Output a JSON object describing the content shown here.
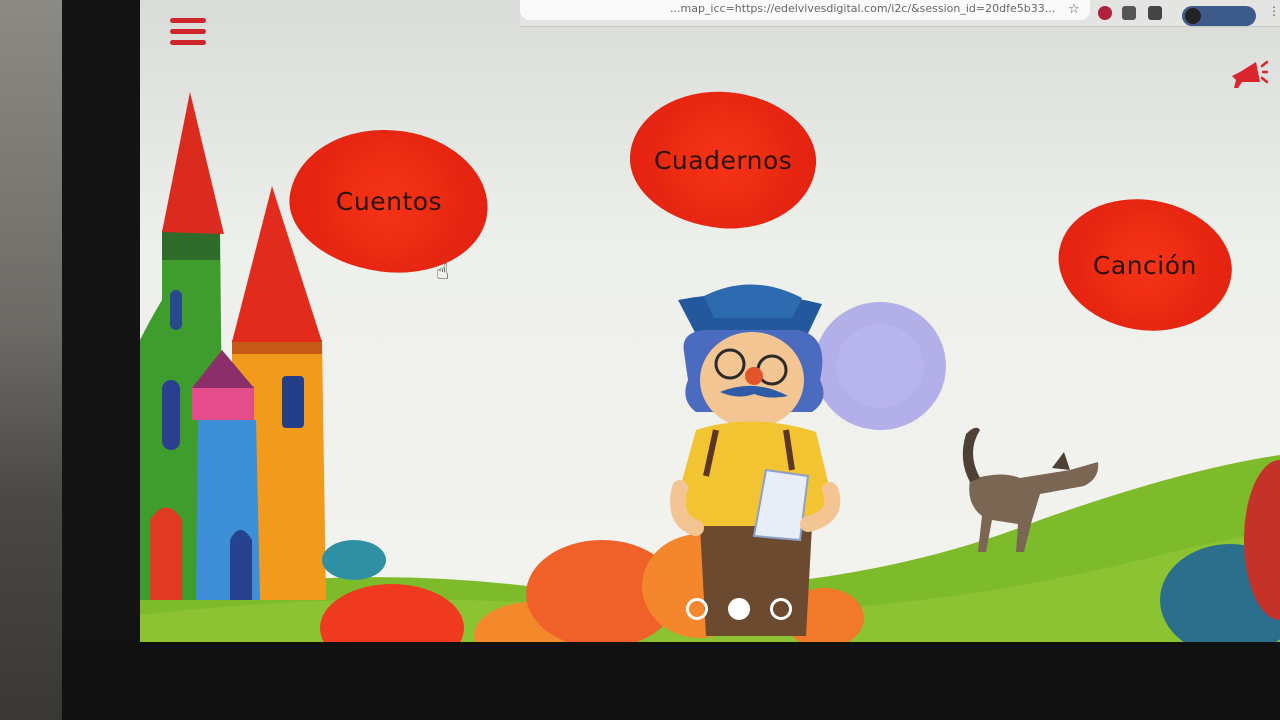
{
  "browser": {
    "url": "...map_icc=https://edelvivesdigital.com/i2c/&session_id=20dfe5b33..."
  },
  "header": {
    "menu_icon": "hamburger-menu-icon",
    "speaker_icon": "megaphone-icon"
  },
  "nav": {
    "cuentos": "Cuentos",
    "cuadernos": "Cuadernos",
    "cancion": "Canción"
  },
  "carousel": {
    "count": 3,
    "active_index": 1
  },
  "colors": {
    "accent_red": "#e62512",
    "sky": "#eef0ec",
    "grass": "#7dbb2a"
  }
}
